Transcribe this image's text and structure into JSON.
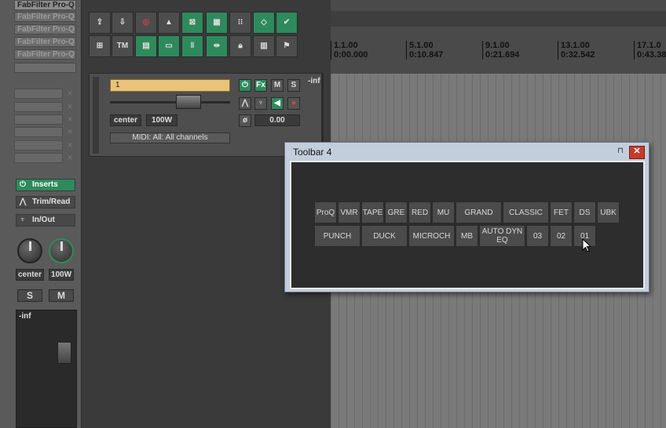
{
  "mixer": {
    "fx_chain": [
      "FabFilter Pro-Q",
      "FabFilter Pro-Q",
      "FabFilter Pro-Q",
      "FabFilter Pro-Q",
      "FabFilter Pro-Q"
    ],
    "inserts_label": "Inserts",
    "trim_label": "Trim/Read",
    "inout_label": "In/Out",
    "pan_label": "center",
    "width_label": "100W",
    "solo_label": "S",
    "mute_label": "M",
    "meter_label": "-inf"
  },
  "main_toolbar": {
    "row1": [
      "",
      "",
      "",
      "",
      "",
      "",
      "",
      ""
    ],
    "tm_label": "TM"
  },
  "track": {
    "name": "1",
    "fx_label": "Fx",
    "mute_label": "M",
    "solo_label": "S",
    "pan_label": "center",
    "width_label": "100W",
    "phase_value": "0.00",
    "midi_input": "MIDI: All: All channels",
    "meter_label": "-inf"
  },
  "timeline": {
    "markers": [
      {
        "bar": "1.1.00",
        "time": "0:00.000"
      },
      {
        "bar": "5.1.00",
        "time": "0:10.847"
      },
      {
        "bar": "9.1.00",
        "time": "0:21.694"
      },
      {
        "bar": "13.1.00",
        "time": "0:32.542"
      },
      {
        "bar": "17.1.0",
        "time": "0:43.38"
      }
    ]
  },
  "toolbar_window": {
    "title": "Toolbar 4",
    "row1": [
      "ProQ",
      "VMR",
      "TAPE",
      "GRE",
      "RED",
      "MU",
      "GRAND",
      "CLASSIC",
      "FET",
      "DS",
      "UBK"
    ],
    "row2": [
      "PUNCH",
      "DUCK",
      "MICROCH",
      "MB",
      "AUTO DYN EQ",
      "03",
      "02",
      "01"
    ]
  },
  "colors": {
    "accent_green": "#2e8a5c",
    "track_name_bg": "#e8c47a",
    "close_red": "#c43c2c"
  }
}
